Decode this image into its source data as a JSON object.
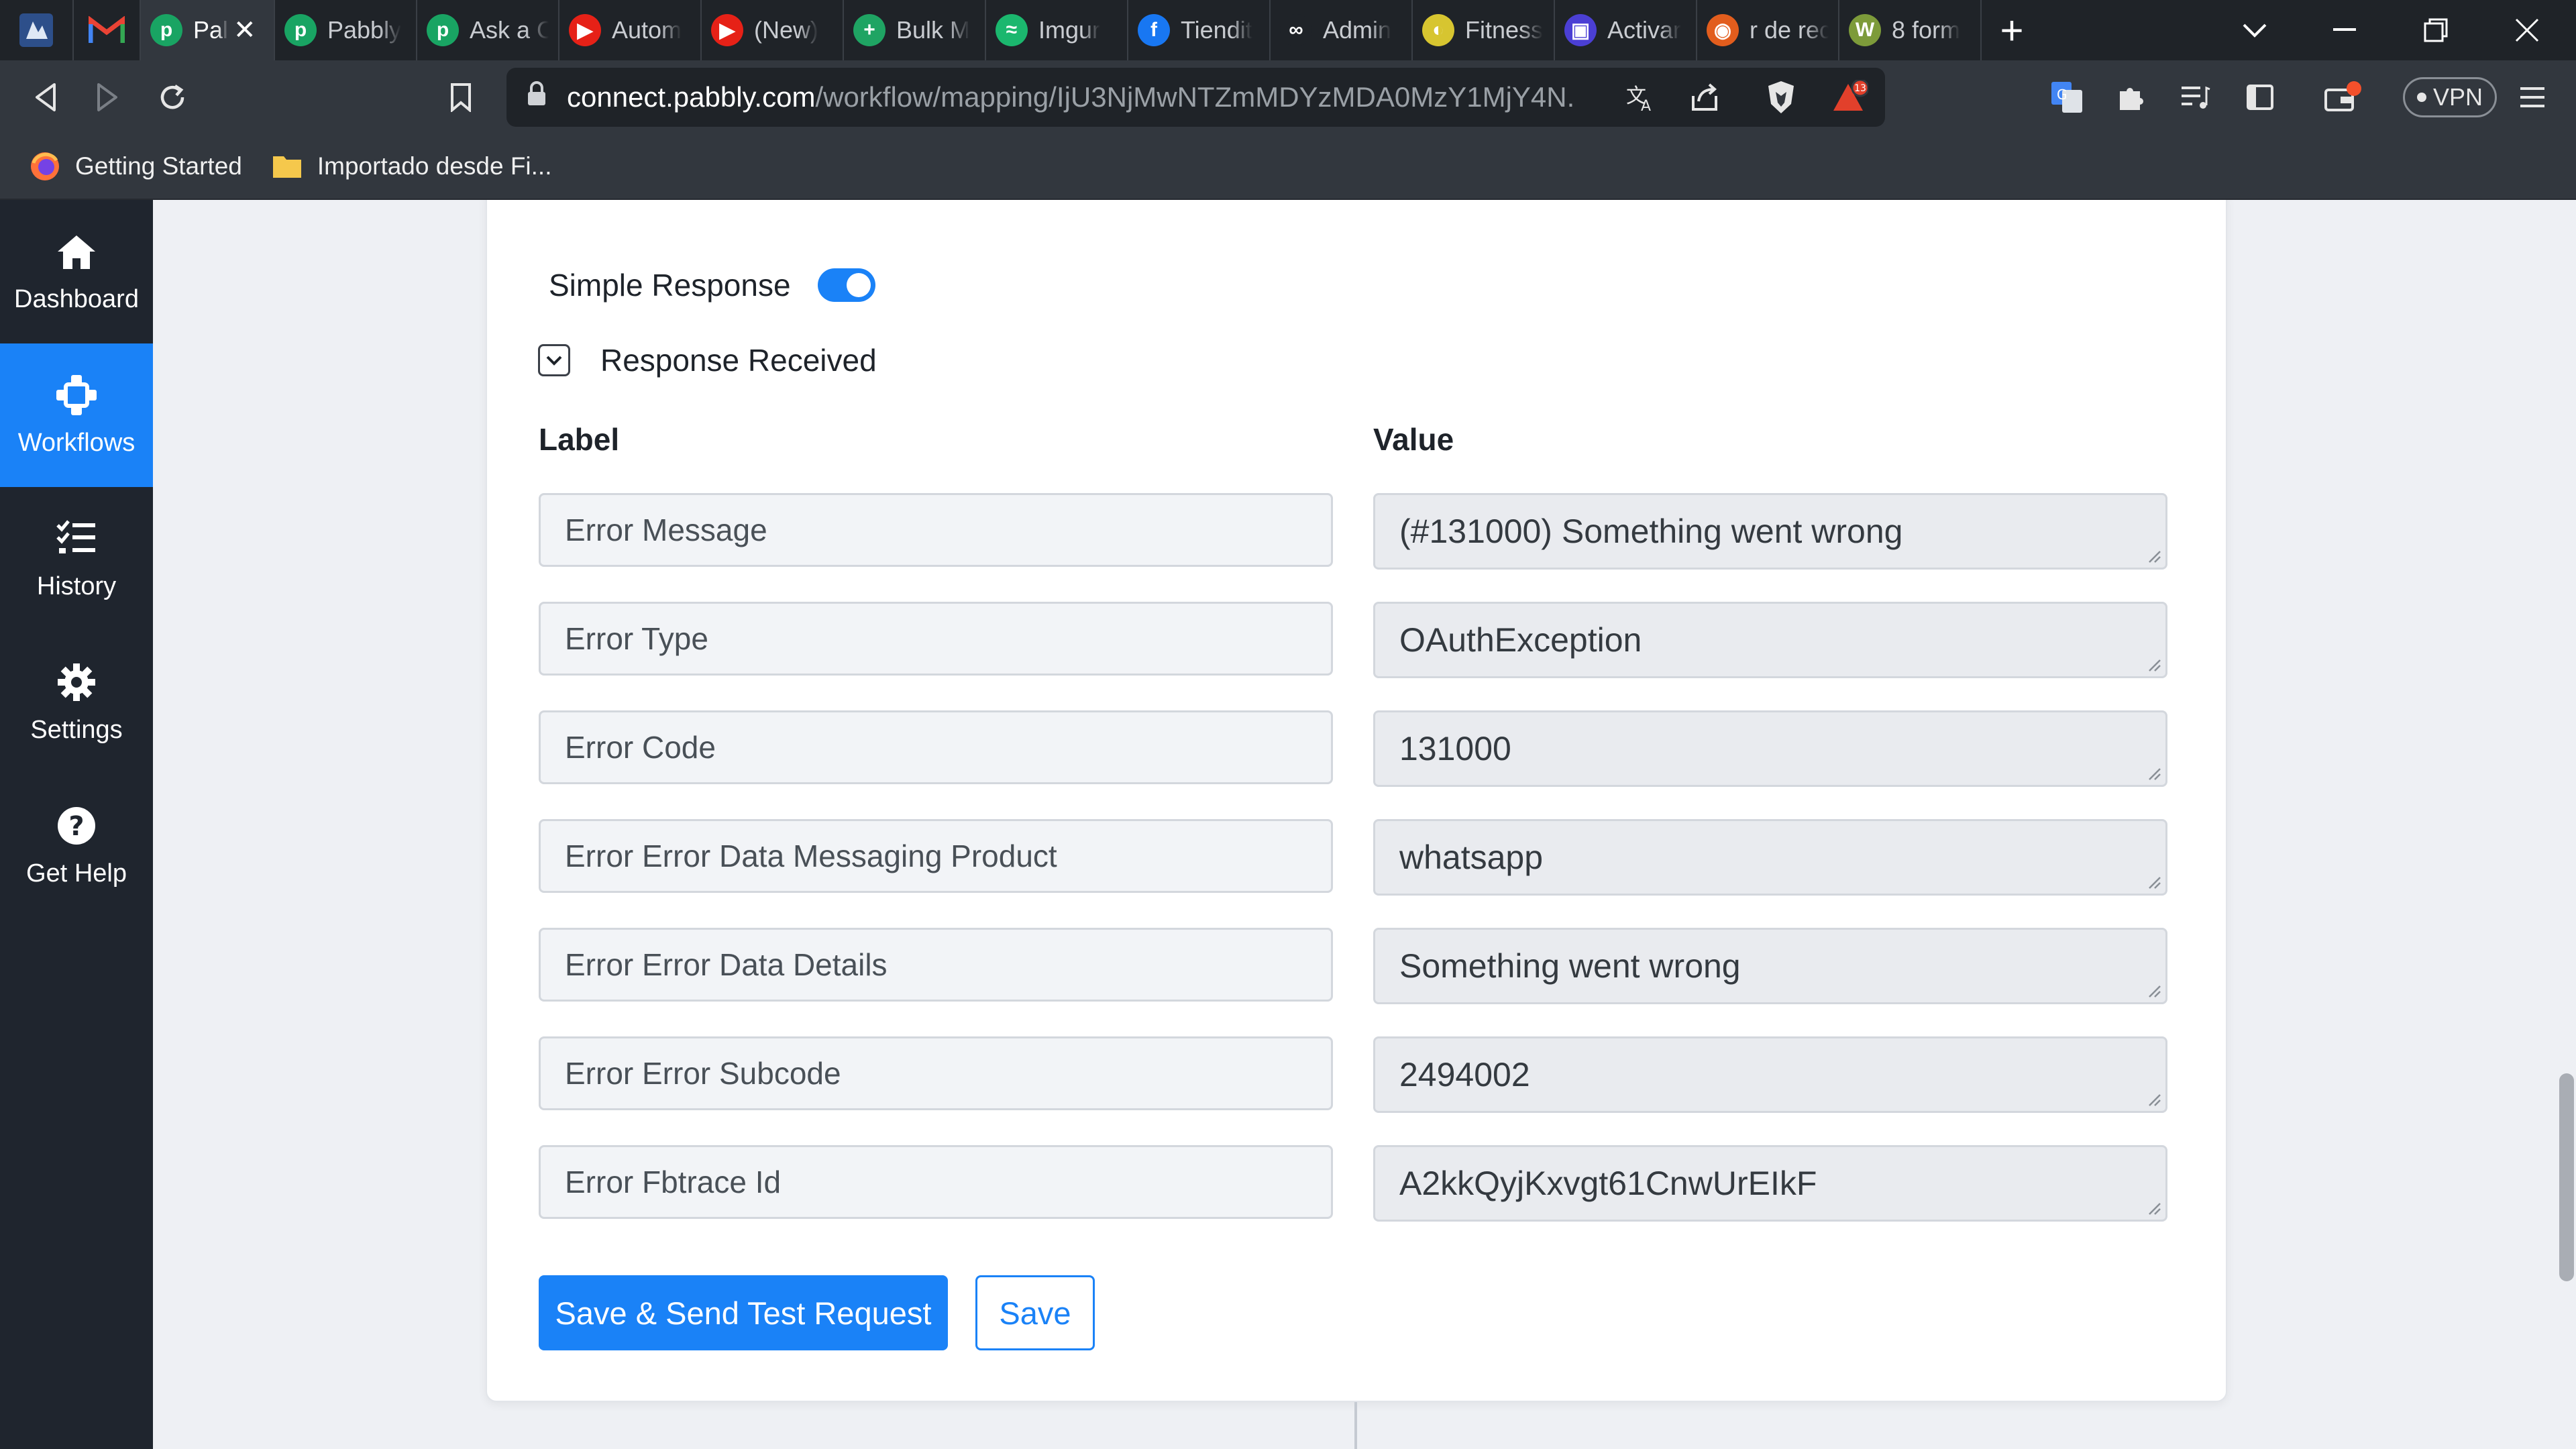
{
  "browser": {
    "tabs": [
      {
        "title": "Pal",
        "active": true,
        "fav_color": "#19a463",
        "fav_glyph": "p"
      },
      {
        "title": "Pabbly",
        "fav_color": "#19a463",
        "fav_glyph": "p"
      },
      {
        "title": "Ask a C",
        "fav_color": "#19a463",
        "fav_glyph": "p"
      },
      {
        "title": "Autom",
        "fav_color": "#e62117",
        "fav_glyph": "▶"
      },
      {
        "title": "(New)",
        "fav_color": "#e62117",
        "fav_glyph": "▶"
      },
      {
        "title": "Bulk M",
        "fav_color": "#1fa463",
        "fav_glyph": "+"
      },
      {
        "title": "Imgur",
        "fav_color": "#1bb76e",
        "fav_glyph": "≈"
      },
      {
        "title": "Tiendit",
        "fav_color": "#1877f2",
        "fav_glyph": "f"
      },
      {
        "title": "Admin",
        "fav_color": "#1f2328",
        "fav_glyph": "∞"
      },
      {
        "title": "Fitness",
        "fav_color": "#d7c530",
        "fav_glyph": "◐"
      },
      {
        "title": "Activar",
        "fav_color": "#4b3fd4",
        "fav_glyph": "▣"
      },
      {
        "title": "r de rec",
        "fav_color": "#e25d1d",
        "fav_glyph": "◉"
      },
      {
        "title": "8 form",
        "fav_color": "#7d9b3a",
        "fav_glyph": "W"
      }
    ],
    "url_host": "connect.pabbly.com",
    "url_path": "/workflow/mapping/IjU3NjMwNTZmMDYzMDA0MzY1MjY4N...",
    "vpn_label": "VPN",
    "brave_badge": "13",
    "bookmarks": [
      {
        "label": "Getting Started",
        "icon": "firefox-icon"
      },
      {
        "label": "Importado desde Fi...",
        "icon": "folder-icon"
      }
    ]
  },
  "sidebar": {
    "items": [
      {
        "label": "Dashboard",
        "icon": "home-icon"
      },
      {
        "label": "Workflows",
        "icon": "workflow-icon",
        "active": true
      },
      {
        "label": "History",
        "icon": "history-icon"
      },
      {
        "label": "Settings",
        "icon": "gear-icon"
      },
      {
        "label": "Get Help",
        "icon": "help-icon"
      }
    ]
  },
  "main": {
    "simple_response_label": "Simple Response",
    "simple_response_on": true,
    "response_received_label": "Response Received",
    "label_header": "Label",
    "value_header": "Value",
    "rows": [
      {
        "label": "Error Message",
        "value": "(#131000) Something went wrong"
      },
      {
        "label": "Error Type",
        "value": "OAuthException"
      },
      {
        "label": "Error Code",
        "value": "131000"
      },
      {
        "label": "Error Error Data Messaging Product",
        "value": "whatsapp"
      },
      {
        "label": "Error Error Data Details",
        "value": "Something went wrong"
      },
      {
        "label": "Error Error Subcode",
        "value": "2494002"
      },
      {
        "label": "Error Fbtrace Id",
        "value": "A2kkQyjKxvgt61CnwUrEIkF"
      }
    ],
    "save_send_label": "Save & Send Test Request",
    "save_label": "Save"
  },
  "colors": {
    "accent": "#1a82f7",
    "sidebar_bg": "#1f252e",
    "chrome_dark": "#1f2328",
    "chrome_mid": "#32373e"
  }
}
